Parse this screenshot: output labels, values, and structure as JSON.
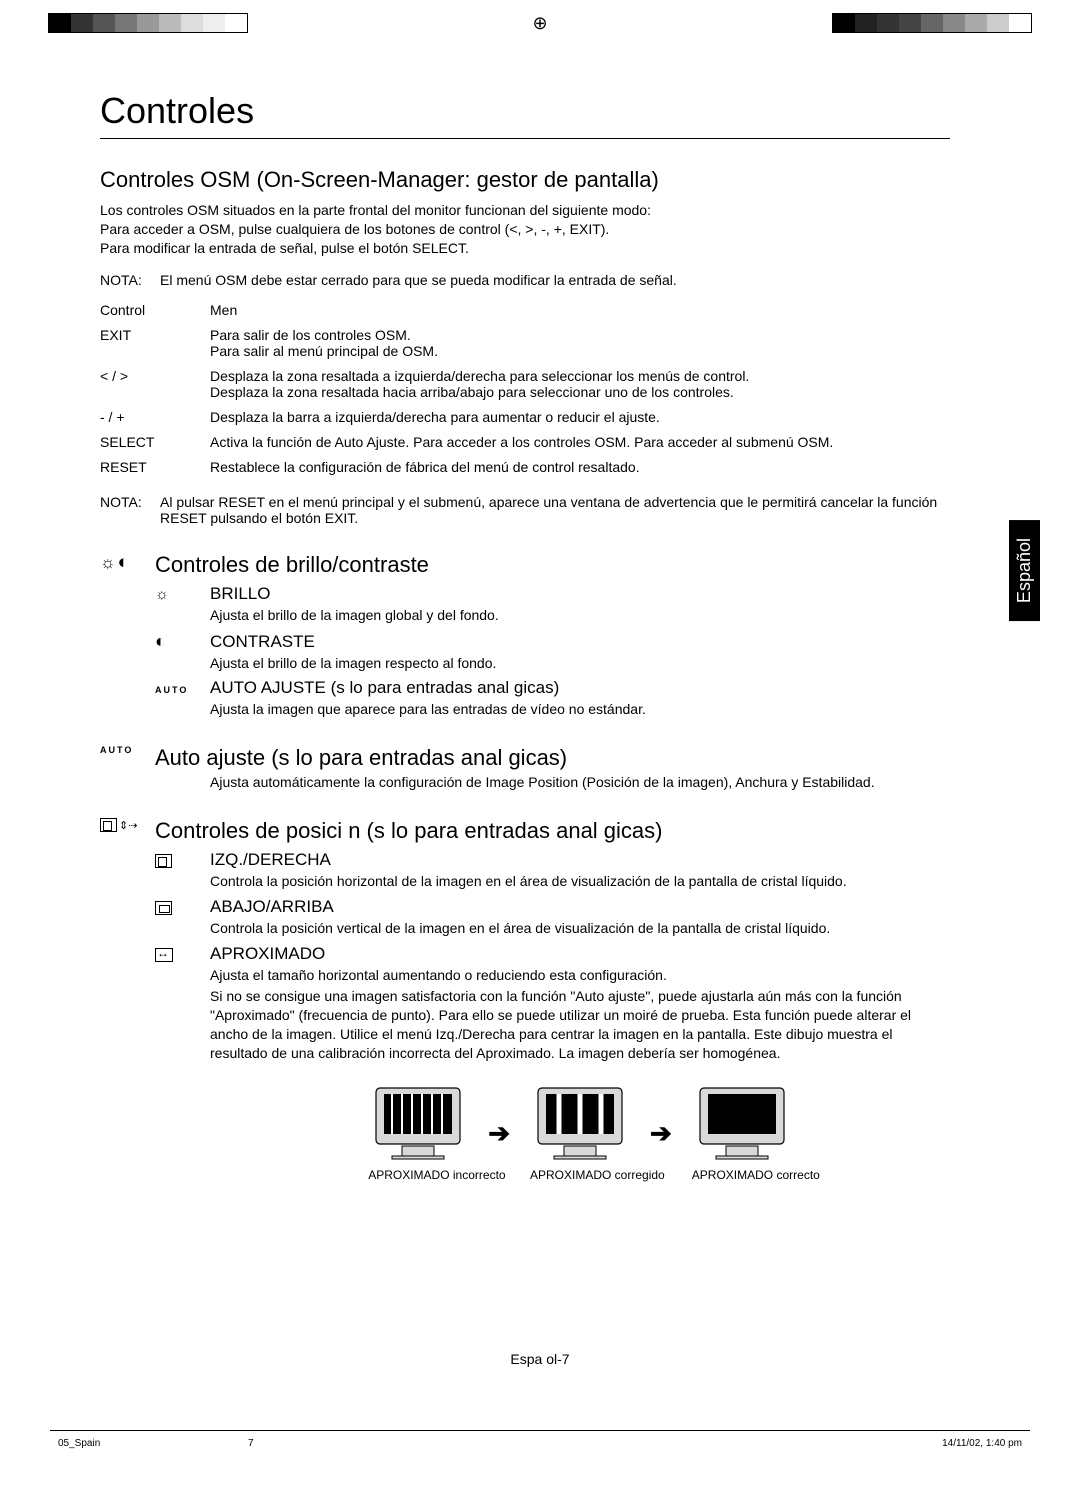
{
  "page_title": "Controles",
  "subtitle": "Controles OSM (On-Screen-Manager: gestor de pantalla)",
  "intro": [
    "Los controles OSM situados en la parte frontal del monitor funcionan del siguiente modo:",
    "Para acceder a OSM, pulse cualquiera de los botones de control (<, >, -, +, EXIT).",
    "Para modificar la entrada de señal, pulse el botón SELECT."
  ],
  "note1_label": "NOTA:",
  "note1_text": "El menú OSM debe estar cerrado para que se pueda modificar la entrada de señal.",
  "table_header": {
    "col1": "Control",
    "col2": "Men"
  },
  "table_rows": [
    {
      "col1": "EXIT",
      "col2": "Para salir de los controles OSM.\nPara salir al menú principal de OSM."
    },
    {
      "col1": "< / >",
      "col2": "Desplaza la zona resaltada a izquierda/derecha para seleccionar los menús de control.\nDesplaza la zona resaltada hacia arriba/abajo para seleccionar uno de los controles."
    },
    {
      "col1": "- / +",
      "col2": "Desplaza la barra a izquierda/derecha para aumentar o reducir el ajuste."
    },
    {
      "col1": "SELECT",
      "col2": "Activa la función de Auto Ajuste. Para acceder a los controles OSM. Para acceder al submenú OSM."
    },
    {
      "col1": "RESET",
      "col2": "Restablece la configuración de fábrica del menú de control resaltado."
    }
  ],
  "note2_label": "NOTA:",
  "note2_text": "Al pulsar RESET en el menú principal y el submenú, aparece una ventana de advertencia que le permitirá cancelar la función RESET pulsando el botón EXIT.",
  "section_bc": {
    "title": "Controles de brillo/contraste",
    "brillo_title": "BRILLO",
    "brillo_desc": "Ajusta el brillo de la imagen global y del fondo.",
    "contraste_title": "CONTRASTE",
    "contraste_desc": "Ajusta el brillo de la imagen respecto al fondo.",
    "auto_item_title": "AUTO AJUSTE (s lo para entradas anal gicas)",
    "auto_item_desc": "Ajusta la imagen que aparece para las entradas de vídeo no estándar."
  },
  "section_auto": {
    "title": "Auto ajuste (s lo para entradas anal gicas)",
    "desc": "Ajusta automáticamente la configuración de Image Position (Posición de la imagen), Anchura y Estabilidad."
  },
  "section_pos": {
    "title": "Controles de posici n (s lo para entradas anal gicas)",
    "izq_title": "IZQ./DERECHA",
    "izq_desc": "Controla la posición horizontal de la imagen en el área de visualización de la pantalla de cristal líquido.",
    "abajo_title": "ABAJO/ARRIBA",
    "abajo_desc": "Controla la posición vertical de la imagen en el área de visualización de la pantalla de cristal líquido.",
    "aprox_title": "APROXIMADO",
    "aprox_desc1": "Ajusta el tamaño horizontal aumentando o reduciendo esta configuración.",
    "aprox_desc2": "Si no se consigue una imagen satisfactoria con la función \"Auto ajuste\", puede ajustarla aún más con la función \"Aproximado\" (frecuencia de punto). Para ello se puede utilizar un moiré de prueba. Esta función puede alterar el ancho de la imagen. Utilice el menú Izq./Derecha para centrar la imagen en la pantalla. Este dibujo muestra el resultado de una calibración incorrecta del Aproximado. La imagen debería ser homogénea."
  },
  "monitors": {
    "cap1": "APROXIMADO incorrecto",
    "cap2": "APROXIMADO corregido",
    "cap3": "APROXIMADO correcto"
  },
  "lang_tab": "Español",
  "footer_page": "Espa ol-7",
  "footer_left": "05_Spain",
  "footer_mid": "7",
  "footer_right": "14/11/02, 1:40 pm",
  "auto_label": "AUTO"
}
